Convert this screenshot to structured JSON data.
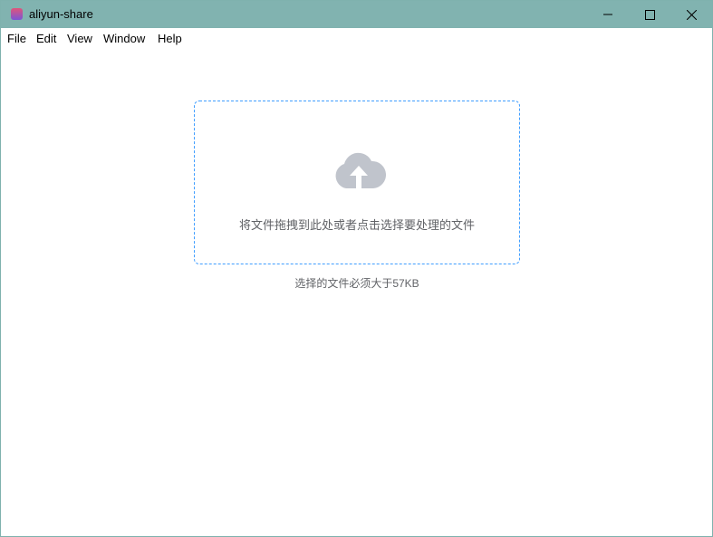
{
  "window": {
    "title": "aliyun-share",
    "titlebar_color": "#81b3b0"
  },
  "menu": [
    {
      "label": "File"
    },
    {
      "label": "Edit"
    },
    {
      "label": "View"
    },
    {
      "label": "Window"
    },
    {
      "label": "Help"
    }
  ],
  "upload": {
    "icon": "cloud-upload-icon",
    "text": "将文件拖拽到此处或者点击选择要处理的文件",
    "accent": "#409eff"
  },
  "tip": "选择的文件必须大于57KB"
}
